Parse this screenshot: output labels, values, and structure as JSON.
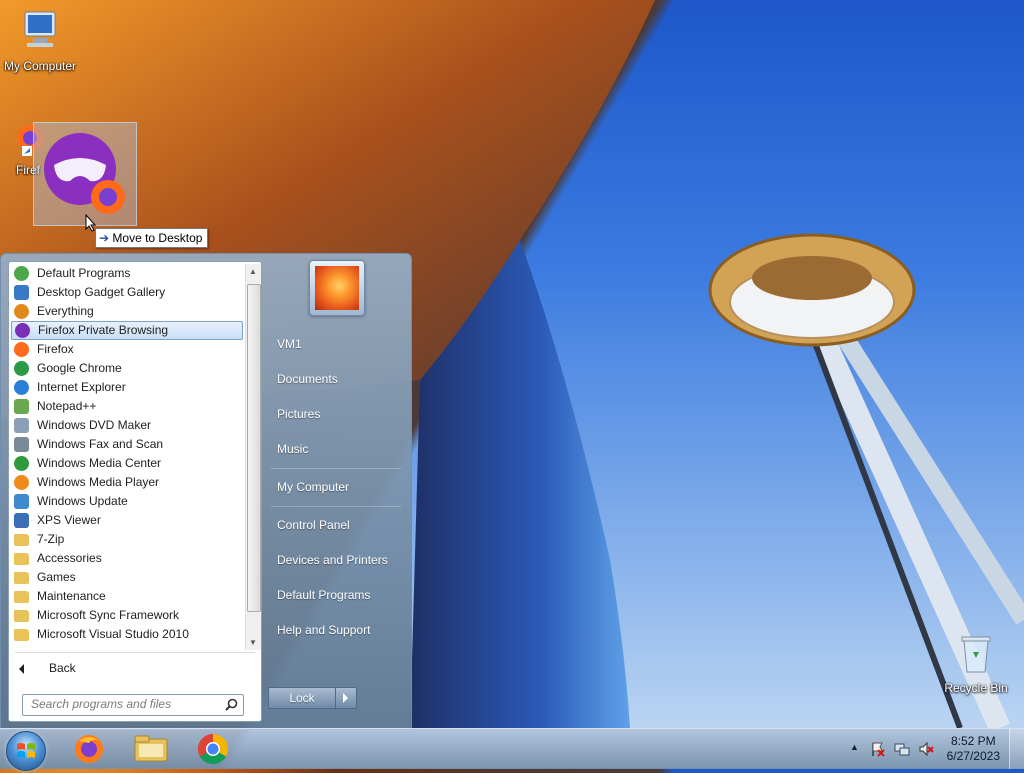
{
  "desktop": {
    "icons": {
      "my_computer": "My Computer",
      "firefox": "Firef",
      "recycle_bin": "Recycle Bin"
    },
    "drag_tooltip": "Move to Desktop"
  },
  "start_menu": {
    "programs": [
      {
        "label": "Default Programs",
        "icon": "default-programs-icon",
        "color": "#4aa84a"
      },
      {
        "label": "Desktop Gadget Gallery",
        "icon": "gadget-gallery-icon",
        "color": "#3a78c8"
      },
      {
        "label": "Everything",
        "icon": "everything-search-icon",
        "color": "#e08a1e"
      },
      {
        "label": "Firefox Private Browsing",
        "icon": "firefox-private-icon",
        "color": "#7a2fb8",
        "selected": true
      },
      {
        "label": "Firefox",
        "icon": "firefox-icon",
        "color": "#ff6a1a"
      },
      {
        "label": "Google Chrome",
        "icon": "chrome-icon",
        "color": "#2a9a47"
      },
      {
        "label": "Internet Explorer",
        "icon": "internet-explorer-icon",
        "color": "#2a7fd6"
      },
      {
        "label": "Notepad++",
        "icon": "notepadpp-icon",
        "color": "#6aa84f"
      },
      {
        "label": "Windows DVD Maker",
        "icon": "dvd-maker-icon",
        "color": "#8aa0b8"
      },
      {
        "label": "Windows Fax and Scan",
        "icon": "fax-scan-icon",
        "color": "#7b8a99"
      },
      {
        "label": "Windows Media Center",
        "icon": "media-center-icon",
        "color": "#2f9a3b"
      },
      {
        "label": "Windows Media Player",
        "icon": "media-player-icon",
        "color": "#f08a1a"
      },
      {
        "label": "Windows Update",
        "icon": "windows-update-icon",
        "color": "#3e8ad0"
      },
      {
        "label": "XPS Viewer",
        "icon": "xps-viewer-icon",
        "color": "#3a6fb8"
      },
      {
        "label": "7-Zip",
        "icon": "folder-icon",
        "color": "#e8c35a"
      },
      {
        "label": "Accessories",
        "icon": "folder-icon",
        "color": "#e8c35a"
      },
      {
        "label": "Games",
        "icon": "folder-icon",
        "color": "#e8c35a"
      },
      {
        "label": "Maintenance",
        "icon": "folder-icon",
        "color": "#e8c35a"
      },
      {
        "label": "Microsoft Sync Framework",
        "icon": "folder-icon",
        "color": "#e8c35a"
      },
      {
        "label": "Microsoft Visual Studio 2010",
        "icon": "folder-icon",
        "color": "#e8c35a"
      }
    ],
    "back_label": "Back",
    "search_placeholder": "Search programs and files",
    "right_items": [
      {
        "label": "VM1",
        "key": "vm1"
      },
      {
        "label": "Documents",
        "key": "documents"
      },
      {
        "label": "Pictures",
        "key": "pictures"
      },
      {
        "label": "Music",
        "key": "music"
      },
      {
        "label": "My Computer",
        "key": "my-computer"
      },
      {
        "label": "Control Panel",
        "key": "control-panel"
      },
      {
        "label": "Devices and Printers",
        "key": "devices-printers"
      },
      {
        "label": "Default Programs",
        "key": "default-programs"
      },
      {
        "label": "Help and Support",
        "key": "help-support"
      }
    ],
    "lock_label": "Lock"
  },
  "taskbar": {
    "pinned": [
      "firefox-icon",
      "file-explorer-icon",
      "chrome-icon"
    ],
    "clock_time": "8:52 PM",
    "clock_date": "6/27/2023"
  }
}
